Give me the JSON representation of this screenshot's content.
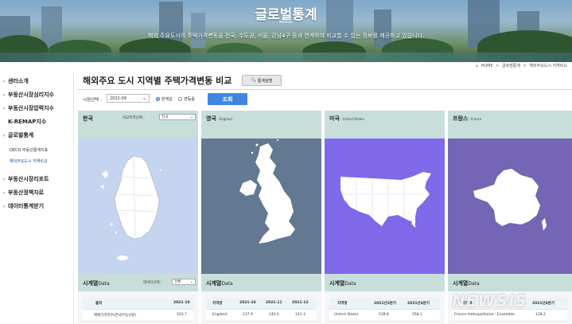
{
  "hero": {
    "title": "글로벌통계",
    "subtitle": "해외 주요도시의 주택가격변동을 전국, 수도권, 서울, 강남4구 등과 연계하여 비교할 수 있는 정보를 제공하고 있습니다."
  },
  "breadcrumb": [
    "HOME",
    "글로벌통계",
    "해외주요도시 지역비교"
  ],
  "sidebar": {
    "items": [
      {
        "label": "센터소개"
      },
      {
        "label": "부동산시장심리지수"
      },
      {
        "label": "부동산시장압력지수"
      },
      {
        "label": "K-REMAP지수"
      },
      {
        "label": "글로벌통계"
      },
      {
        "label": "부동산시장리포트"
      },
      {
        "label": "부동산정책자료"
      },
      {
        "label": "데이터통계받기"
      }
    ],
    "subitems": [
      {
        "label": "OECD 부동산통계지표"
      },
      {
        "label": "해외주요도시 지역비교"
      }
    ]
  },
  "page": {
    "title": "해외주요 도시 지역별 주택가격변동 비교",
    "guide_button": "통계설명"
  },
  "filter": {
    "time_label": "시점선택 :",
    "time_value": "2022-09",
    "radio_current": "현재값",
    "radio_change": "변동률",
    "search_label": "조회"
  },
  "colors": {
    "card_header": "#c8dedb",
    "korea_map_bg": "#c6d5ef",
    "england_map_bg": "#637891",
    "us_map_bg": "#7f69e8",
    "france_map_bg": "#7466b5",
    "search_button": "#3f86e0"
  },
  "cards": [
    {
      "name": "한국",
      "name_en": "",
      "compare_label": "비교지역선택 :",
      "compare_value": "전국",
      "series_title": "시계열",
      "series_suffix": "Data",
      "data_select_label": "데이터선택 :",
      "data_select_value": "전체",
      "table": {
        "headers": [
          "출처",
          "2021-10"
        ],
        "rows": [
          [
            "매매가격지수(한국부동산원)",
            "103.7"
          ]
        ]
      }
    },
    {
      "name": "영국",
      "name_en": "- England",
      "series_title": "시계열",
      "series_suffix": "Data",
      "table": {
        "headers": [
          "지역명",
          "2021-10",
          "2021-11",
          "2021-12"
        ],
        "rows": [
          [
            "England",
            "137.9",
            "140.5",
            "141.3"
          ]
        ]
      }
    },
    {
      "name": "미국",
      "name_en": "- United States",
      "series_title": "시계열",
      "series_suffix": "Data",
      "table": {
        "headers": [
          "지역명",
          "2021년3분기",
          "2021년4분기"
        ],
        "rows": [
          [
            "United States",
            "539.6",
            "558.1"
          ]
        ]
      }
    },
    {
      "name": "프랑스",
      "name_en": "- France",
      "series_title": "시계열",
      "series_suffix": "Data",
      "table": {
        "headers": [
          "지역명",
          "2021년4분기"
        ],
        "rows": [
          [
            "France metropolitaine - Ensemble",
            "128.2"
          ]
        ]
      }
    }
  ],
  "watermark": "NEWSIS"
}
